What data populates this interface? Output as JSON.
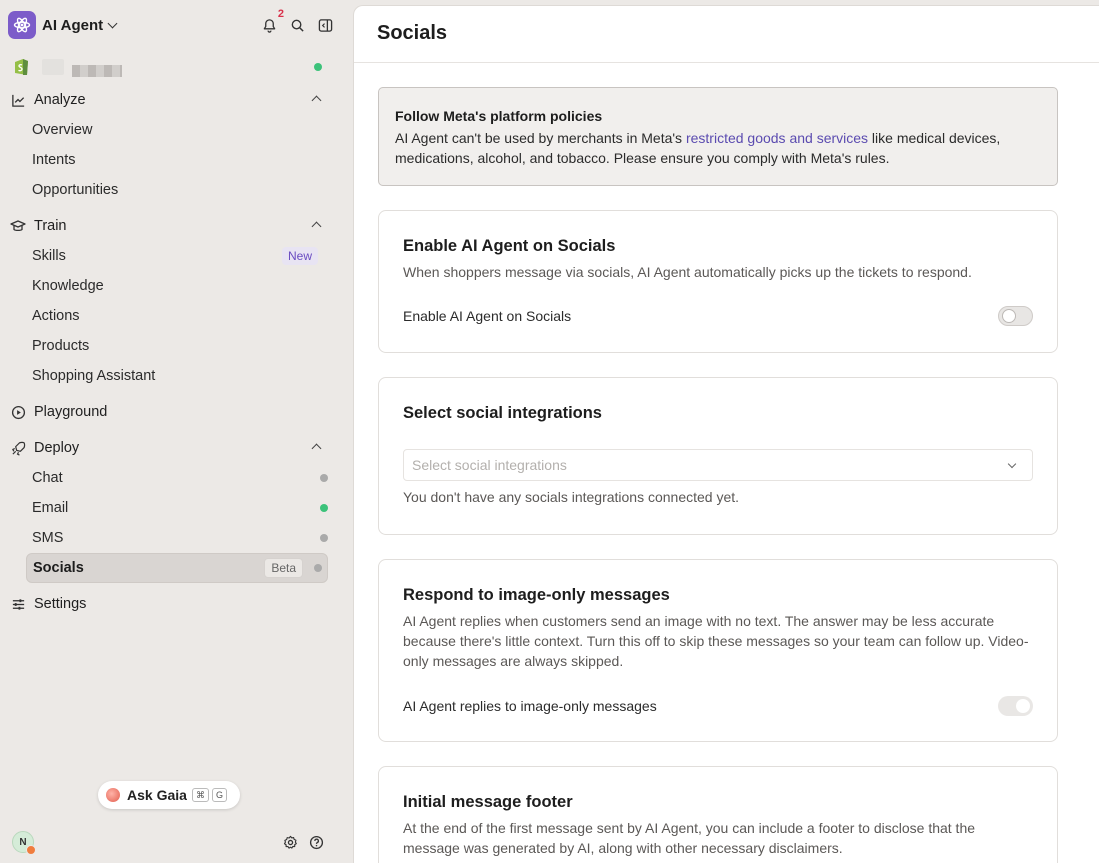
{
  "app": {
    "name": "AI Agent",
    "notification_count": "2"
  },
  "nav": {
    "analyze": {
      "label": "Analyze",
      "items": [
        {
          "label": "Overview"
        },
        {
          "label": "Intents"
        },
        {
          "label": "Opportunities"
        }
      ]
    },
    "train": {
      "label": "Train",
      "items": [
        {
          "label": "Skills",
          "badge": "New"
        },
        {
          "label": "Knowledge"
        },
        {
          "label": "Actions"
        },
        {
          "label": "Products"
        },
        {
          "label": "Shopping Assistant"
        }
      ]
    },
    "playground": {
      "label": "Playground"
    },
    "deploy": {
      "label": "Deploy",
      "items": [
        {
          "label": "Chat",
          "status": "inactive"
        },
        {
          "label": "Email",
          "status": "active"
        },
        {
          "label": "SMS",
          "status": "inactive"
        },
        {
          "label": "Socials",
          "badge": "Beta",
          "status": "inactive",
          "selected": true
        }
      ]
    },
    "settings": {
      "label": "Settings"
    }
  },
  "ask_gaia": {
    "label": "Ask Gaia",
    "shortcut_mod": "⌘",
    "shortcut_key": "G"
  },
  "user": {
    "initial": "N"
  },
  "page": {
    "title": "Socials",
    "notice": {
      "title": "Follow Meta's platform policies",
      "text_before": "AI Agent can't be used by merchants in Meta's ",
      "link": "restricted goods and services",
      "text_after": " like medical devices, medications, alcohol, and tobacco. Please ensure you comply with Meta's rules."
    },
    "enable_card": {
      "title": "Enable AI Agent on Socials",
      "description": "When shoppers message via socials, AI Agent automatically picks up the tickets to respond.",
      "toggle_label": "Enable AI Agent on Socials",
      "toggle_on": false
    },
    "integrations_card": {
      "title": "Select social integrations",
      "placeholder": "Select social integrations",
      "helper": "You don't have any socials integrations connected yet."
    },
    "image_card": {
      "title": "Respond to image-only messages",
      "description": "AI Agent replies when customers send an image with no text. The answer may be less accurate because there's little context. Turn this off to skip these messages so your team can follow up. Video-only messages are always skipped.",
      "toggle_label": "AI Agent replies to image-only messages",
      "toggle_on": true
    },
    "footer_card": {
      "title": "Initial message footer",
      "description": "At the end of the first message sent by AI Agent, you can include a footer to disclose that the message was generated by AI, along with other necessary disclaimers."
    }
  },
  "colors": {
    "accent": "#7c5cc9",
    "link": "#5b4bb0",
    "status_active": "#3cc27a",
    "status_inactive": "#aaaaaa",
    "notification": "#d9304a"
  }
}
